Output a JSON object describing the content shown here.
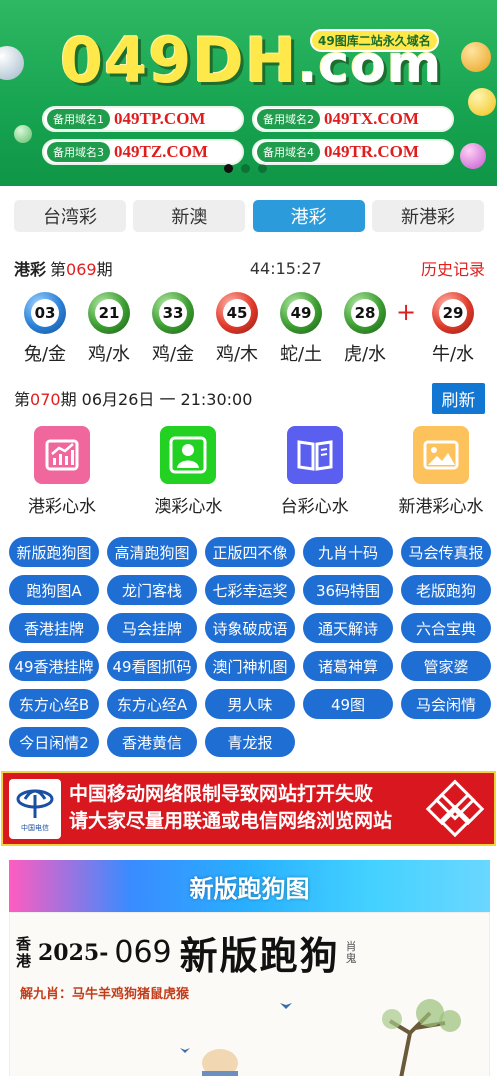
{
  "banner": {
    "brand_main": "049DH",
    "brand_tld": ".com",
    "tagline": "49图库二站永久域名",
    "domains": [
      {
        "tag": "备用域名1",
        "url": "049TP.COM"
      },
      {
        "tag": "备用域名2",
        "url": "049TX.COM"
      },
      {
        "tag": "备用域名3",
        "url": "049TZ.COM"
      },
      {
        "tag": "备用域名4",
        "url": "049TR.COM"
      }
    ],
    "slide_count": 3,
    "active_slide": 1
  },
  "tabs": [
    {
      "label": "台湾彩",
      "active": false
    },
    {
      "label": "新澳",
      "active": false
    },
    {
      "label": "港彩",
      "active": true
    },
    {
      "label": "新港彩",
      "active": false
    }
  ],
  "draw": {
    "lottery": "港彩",
    "issue_prefix": "第",
    "issue": "069",
    "issue_suffix": "期",
    "countdown": "44:15:27",
    "history_label": "历史记录",
    "balls": [
      {
        "num": "03",
        "color": "blue",
        "zodiac": "兔/金"
      },
      {
        "num": "21",
        "color": "green",
        "zodiac": "鸡/水"
      },
      {
        "num": "33",
        "color": "green",
        "zodiac": "鸡/金"
      },
      {
        "num": "45",
        "color": "red",
        "zodiac": "鸡/木"
      },
      {
        "num": "49",
        "color": "green",
        "zodiac": "蛇/土"
      },
      {
        "num": "28",
        "color": "green",
        "zodiac": "虎/水"
      }
    ],
    "plus": "+",
    "special": {
      "num": "29",
      "color": "red",
      "zodiac": "牛/水"
    },
    "next_prefix": "第",
    "next_issue": "070",
    "next_suffix": "期 06月26日 一 21:30:00",
    "refresh_label": "刷新"
  },
  "shortcuts": [
    {
      "label": "港彩心水",
      "icon": "chart-icon",
      "color": "#f0679e"
    },
    {
      "label": "澳彩心水",
      "icon": "user-icon",
      "color": "#22d122"
    },
    {
      "label": "台彩心水",
      "icon": "book-icon",
      "color": "#5b5ff0"
    },
    {
      "label": "新港彩心水",
      "icon": "image-icon",
      "color": "#fdc25c"
    }
  ],
  "links": [
    "新版跑狗图",
    "高清跑狗图",
    "正版四不像",
    "九肖十码",
    "马会传真报",
    "跑狗图A",
    "龙门客栈",
    "七彩幸运奖",
    "36码特围",
    "老版跑狗",
    "香港挂牌",
    "马会挂牌",
    "诗象破成语",
    "通天解诗",
    "六合宝典",
    "49香港挂牌",
    "49看图抓码",
    "澳门神机图",
    "诸葛神算",
    "管家婆",
    "东方心经B",
    "东方心经A",
    "男人味",
    "49图",
    "马会闲情",
    "今日闲情2",
    "香港黄信",
    "青龙报"
  ],
  "notice": {
    "line1": "中国移动网络限制导致网站打开失败",
    "line2": "请大家尽量用联通或电信网络浏览网站",
    "logo_caption": "中国电信",
    "logo_caption_en": "CHINA TELECOM"
  },
  "section": {
    "title": "新版跑狗图",
    "poster_hk": "香港",
    "poster_year": "2025-",
    "poster_issue": "069",
    "poster_title": "新版跑狗",
    "poster_stamp": "肖鬼",
    "poster_hint": "解九肖：马牛羊鸡狗猪鼠虎猴"
  }
}
